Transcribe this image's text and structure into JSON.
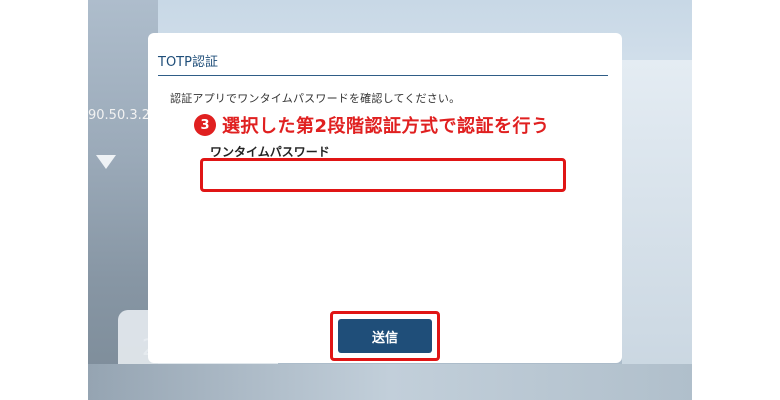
{
  "background": {
    "ip_fragment": "90.50.3.2",
    "deco_number": "2"
  },
  "dialog": {
    "title": "TOTP認証",
    "description": "認証アプリでワンタイムパスワードを確認してください。",
    "step_number": "3",
    "step_instruction": "選択した第2段階認証方式で認証を行う",
    "otp_label": "ワンタイムパスワード",
    "otp_value": "",
    "submit_label": "送信"
  },
  "colors": {
    "accent": "#1f4e79",
    "highlight": "#e01515"
  }
}
